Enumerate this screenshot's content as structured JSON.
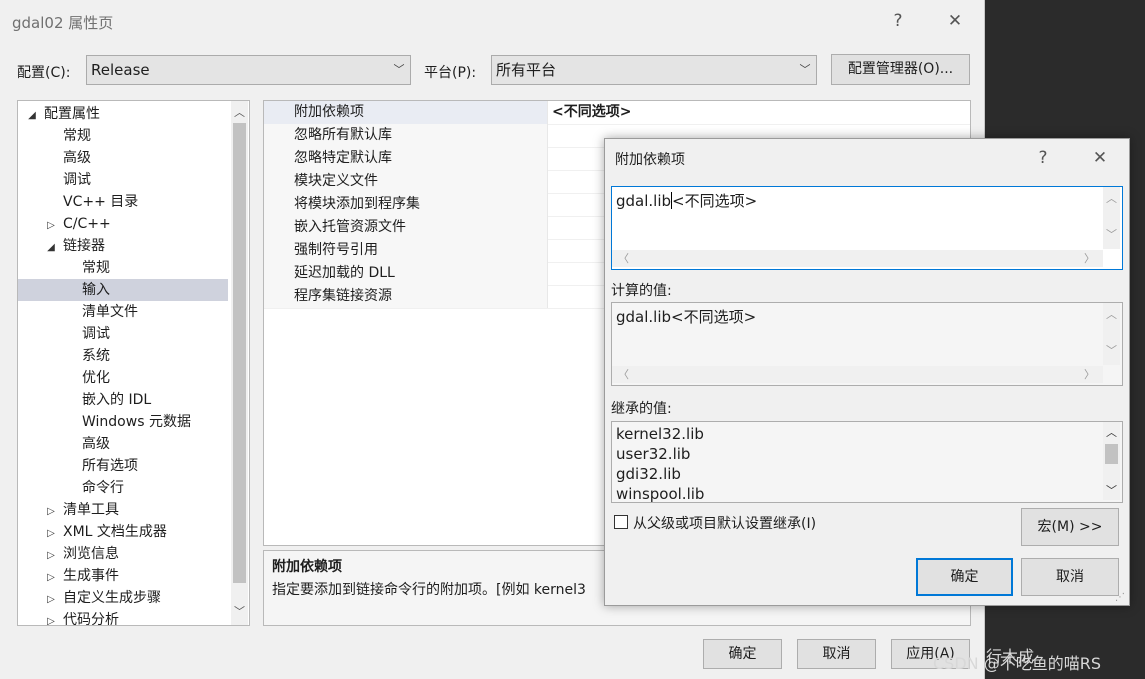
{
  "main": {
    "title": "gdal02 属性页",
    "help": "?",
    "close": "✕",
    "config_label": "配置(C):",
    "config_value": "Release",
    "platform_label": "平台(P):",
    "platform_value": "所有平台",
    "config_manager": "配置管理器(O)...",
    "ok": "确定",
    "cancel": "取消",
    "apply": "应用(A)"
  },
  "tree": [
    {
      "label": "配置属性",
      "depth": 0,
      "caret": "◢"
    },
    {
      "label": "常规",
      "depth": 1,
      "caret": ""
    },
    {
      "label": "高级",
      "depth": 1,
      "caret": ""
    },
    {
      "label": "调试",
      "depth": 1,
      "caret": ""
    },
    {
      "label": "VC++ 目录",
      "depth": 1,
      "caret": ""
    },
    {
      "label": "C/C++",
      "depth": 1,
      "caret": "▷"
    },
    {
      "label": "链接器",
      "depth": 1,
      "caret": "◢"
    },
    {
      "label": "常规",
      "depth": 2,
      "caret": ""
    },
    {
      "label": "输入",
      "depth": 2,
      "caret": "",
      "selected": true
    },
    {
      "label": "清单文件",
      "depth": 2,
      "caret": ""
    },
    {
      "label": "调试",
      "depth": 2,
      "caret": ""
    },
    {
      "label": "系统",
      "depth": 2,
      "caret": ""
    },
    {
      "label": "优化",
      "depth": 2,
      "caret": ""
    },
    {
      "label": "嵌入的 IDL",
      "depth": 2,
      "caret": ""
    },
    {
      "label": "Windows 元数据",
      "depth": 2,
      "caret": ""
    },
    {
      "label": "高级",
      "depth": 2,
      "caret": ""
    },
    {
      "label": "所有选项",
      "depth": 2,
      "caret": ""
    },
    {
      "label": "命令行",
      "depth": 2,
      "caret": ""
    },
    {
      "label": "清单工具",
      "depth": 1,
      "caret": "▷"
    },
    {
      "label": "XML 文档生成器",
      "depth": 1,
      "caret": "▷"
    },
    {
      "label": "浏览信息",
      "depth": 1,
      "caret": "▷"
    },
    {
      "label": "生成事件",
      "depth": 1,
      "caret": "▷"
    },
    {
      "label": "自定义生成步骤",
      "depth": 1,
      "caret": "▷"
    },
    {
      "label": "代码分析",
      "depth": 1,
      "caret": "▷"
    }
  ],
  "props": [
    {
      "name": "附加依赖项",
      "value": "<不同选项>"
    },
    {
      "name": "忽略所有默认库",
      "value": ""
    },
    {
      "name": "忽略特定默认库",
      "value": ""
    },
    {
      "name": "模块定义文件",
      "value": ""
    },
    {
      "name": "将模块添加到程序集",
      "value": ""
    },
    {
      "name": "嵌入托管资源文件",
      "value": ""
    },
    {
      "name": "强制符号引用",
      "value": ""
    },
    {
      "name": "延迟加载的 DLL",
      "value": ""
    },
    {
      "name": "程序集链接资源",
      "value": ""
    }
  ],
  "desc": {
    "title": "附加依赖项",
    "text": "指定要添加到链接命令行的附加项。[例如 kernel3"
  },
  "popup": {
    "title": "附加依赖项",
    "help": "?",
    "close": "✕",
    "input_before": "gdal.lib",
    "input_after": "<不同选项>",
    "computed_label": "计算的值:",
    "computed_value": "gdal.lib<不同选项>",
    "inherited_label": "继承的值:",
    "inherited": [
      "kernel32.lib",
      "user32.lib",
      "gdi32.lib",
      "winspool.lib"
    ],
    "inherit_checkbox": "从父级或项目默认设置继承(I)",
    "macro": "宏(M) >>",
    "ok": "确定",
    "cancel": "取消"
  },
  "background": {
    "text1": "行木成",
    "watermark": "CSDN @不吃鱼的喵RS"
  }
}
